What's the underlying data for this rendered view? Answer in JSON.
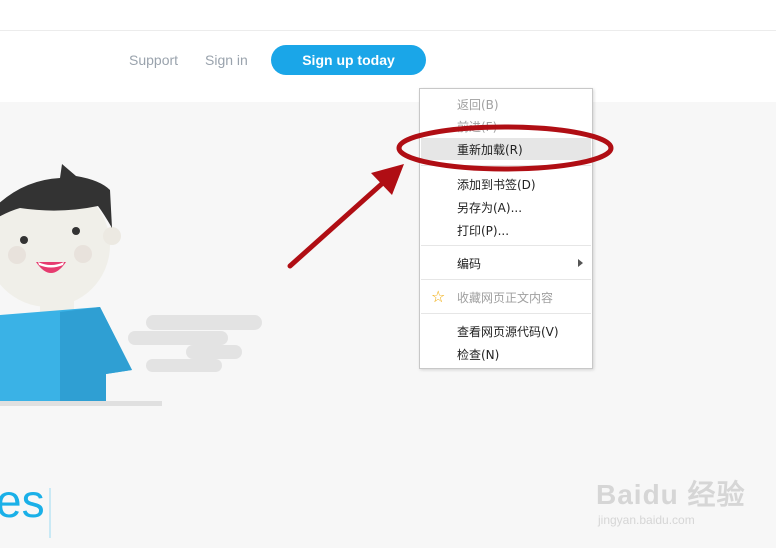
{
  "header": {
    "nav": [
      "Support",
      "Sign in"
    ],
    "cta_label": "Sign up today"
  },
  "hero": {
    "partial_text": "es"
  },
  "context_menu": {
    "items": [
      {
        "label": "返回(B)",
        "enabled": false
      },
      {
        "label": "前进(F)",
        "enabled": false
      },
      {
        "label": "重新加载(R)",
        "enabled": true,
        "highlighted": true
      },
      {
        "label": "添加到书签(D)",
        "enabled": true
      },
      {
        "label": "另存为(A)...",
        "enabled": true
      },
      {
        "label": "打印(P)...",
        "enabled": true
      },
      {
        "label": "编码",
        "enabled": true,
        "submenu": true
      },
      {
        "label": "收藏网页正文内容",
        "enabled": false,
        "icon": "star-icon"
      },
      {
        "label": "查看网页源代码(V)",
        "enabled": true
      },
      {
        "label": "检查(N)",
        "enabled": true
      }
    ]
  },
  "annotation": {
    "color": "#b00e14"
  },
  "watermark": {
    "brand": "Baidu 经验",
    "url": "jingyan.baidu.com"
  },
  "colors": {
    "accent": "#1aa6e8",
    "hero_bg": "#f7f7f7"
  }
}
